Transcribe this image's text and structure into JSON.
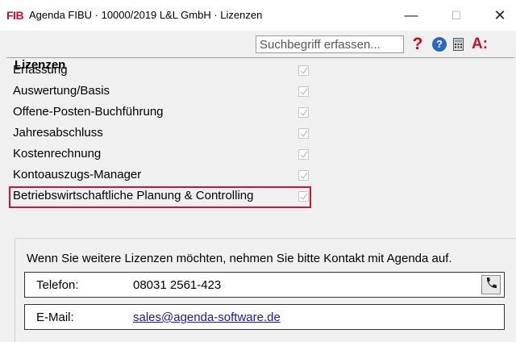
{
  "window": {
    "logo": "FIB",
    "title": "Agenda FIBU · 10000/2019 L&L GmbH · Lizenzen",
    "minimize": "—",
    "maximize": "☐",
    "close": "✕"
  },
  "toolbar": {
    "search_placeholder": "Suchbegriff erfassen...",
    "question": "?",
    "help": "?",
    "a_label": "A:"
  },
  "licenses": {
    "title": "Lizenzen",
    "items": [
      {
        "label": "Erfassung",
        "checked": true
      },
      {
        "label": "Auswertung/Basis",
        "checked": true
      },
      {
        "label": "Offene-Posten-Buchführung",
        "checked": true
      },
      {
        "label": "Jahresabschluss",
        "checked": true
      },
      {
        "label": "Kostenrechnung",
        "checked": true
      },
      {
        "label": "Kontoauszugs-Manager",
        "checked": true
      },
      {
        "label": "Betriebswirtschaftliche Planung & Controlling",
        "checked": true
      }
    ],
    "highlight_color": "#c8173c"
  },
  "contact": {
    "message": "Wenn Sie weitere Lizenzen möchten, nehmen Sie bitte Kontakt mit Agenda auf.",
    "phone_label": "Telefon:",
    "phone_value": "08031 2561-423",
    "email_label": "E-Mail:",
    "email_value": "sales@agenda-software.de"
  },
  "colors": {
    "brand_red": "#c8102e",
    "help_blue": "#2a6ab8",
    "link_blue": "#1a1aa6"
  }
}
